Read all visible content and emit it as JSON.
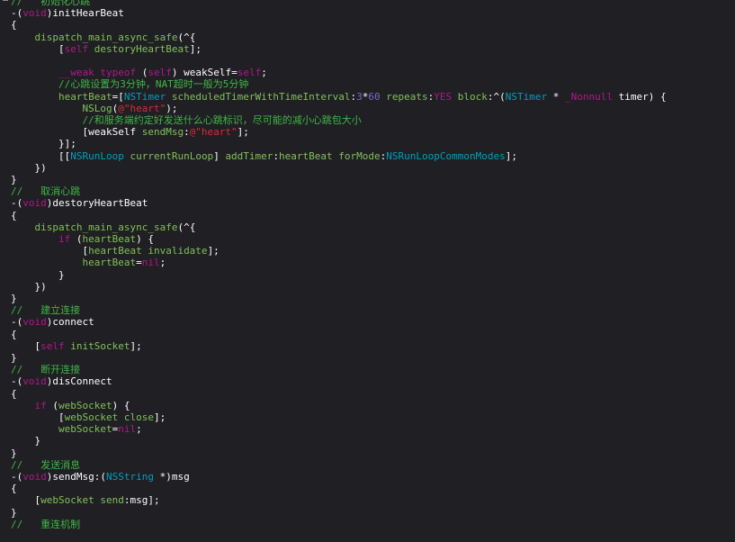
{
  "editor": {
    "background": "#1f1f24",
    "colors": {
      "plain": "#ffffff",
      "comment": "#41b645",
      "keyword": "#b21889",
      "class": "#00a0be",
      "method": "#83c057",
      "number": "#786dc4",
      "string": "#db2c38"
    },
    "lines": [
      [
        [
          "comment",
          "//   初始化心跳"
        ]
      ],
      [
        [
          "plain",
          "-("
        ],
        [
          "keyword",
          "void"
        ],
        [
          "plain",
          ")initHearBeat"
        ]
      ],
      [
        [
          "plain",
          "{"
        ]
      ],
      [
        [
          "plain",
          "    "
        ],
        [
          "method",
          "dispatch_main_async_safe"
        ],
        [
          "plain",
          "(^{"
        ]
      ],
      [
        [
          "plain",
          "        ["
        ],
        [
          "keyword",
          "self"
        ],
        [
          "plain",
          " "
        ],
        [
          "method",
          "destoryHeartBeat"
        ],
        [
          "plain",
          "];"
        ]
      ],
      [
        [
          "plain",
          ""
        ]
      ],
      [
        [
          "plain",
          "        "
        ],
        [
          "keyword",
          "__weak"
        ],
        [
          "plain",
          " "
        ],
        [
          "keyword",
          "typeof"
        ],
        [
          "plain",
          " ("
        ],
        [
          "keyword",
          "self"
        ],
        [
          "plain",
          ") weakSelf="
        ],
        [
          "keyword",
          "self"
        ],
        [
          "plain",
          ";"
        ]
      ],
      [
        [
          "plain",
          "        "
        ],
        [
          "comment",
          "//心跳设置为3分钟，NAT超时一般为5分钟"
        ]
      ],
      [
        [
          "plain",
          "        "
        ],
        [
          "prop",
          "heartBeat"
        ],
        [
          "plain",
          "=["
        ],
        [
          "class",
          "NSTimer"
        ],
        [
          "plain",
          " "
        ],
        [
          "method",
          "scheduledTimerWithTimeInterval"
        ],
        [
          "plain",
          ":"
        ],
        [
          "number",
          "3"
        ],
        [
          "plain",
          "*"
        ],
        [
          "number",
          "60"
        ],
        [
          "plain",
          " "
        ],
        [
          "method",
          "repeats"
        ],
        [
          "plain",
          ":"
        ],
        [
          "keyword",
          "YES"
        ],
        [
          "plain",
          " "
        ],
        [
          "method",
          "block"
        ],
        [
          "plain",
          ":^("
        ],
        [
          "class",
          "NSTimer"
        ],
        [
          "plain",
          " * "
        ],
        [
          "keyword",
          "_Nonnull"
        ],
        [
          "plain",
          " timer) {"
        ]
      ],
      [
        [
          "plain",
          "            "
        ],
        [
          "method",
          "NSLog"
        ],
        [
          "plain",
          "("
        ],
        [
          "string",
          "@\"heart\""
        ],
        [
          "plain",
          ");"
        ]
      ],
      [
        [
          "plain",
          "            "
        ],
        [
          "comment",
          "//和服务端约定好发送什么心跳标识，尽可能的减小心跳包大小"
        ]
      ],
      [
        [
          "plain",
          "            [weakSelf "
        ],
        [
          "method",
          "sendMsg"
        ],
        [
          "plain",
          ":"
        ],
        [
          "string",
          "@\"heart\""
        ],
        [
          "plain",
          "];"
        ]
      ],
      [
        [
          "plain",
          "        }];"
        ]
      ],
      [
        [
          "plain",
          "        [["
        ],
        [
          "class",
          "NSRunLoop"
        ],
        [
          "plain",
          " "
        ],
        [
          "method",
          "currentRunLoop"
        ],
        [
          "plain",
          "] "
        ],
        [
          "method",
          "addTimer"
        ],
        [
          "plain",
          ":"
        ],
        [
          "prop",
          "heartBeat"
        ],
        [
          "plain",
          " "
        ],
        [
          "method",
          "forMode"
        ],
        [
          "plain",
          ":"
        ],
        [
          "class",
          "NSRunLoopCommonModes"
        ],
        [
          "plain",
          "];"
        ]
      ],
      [
        [
          "plain",
          "    })"
        ]
      ],
      [
        [
          "plain",
          "}"
        ]
      ],
      [
        [
          "comment",
          "//   取消心跳"
        ]
      ],
      [
        [
          "plain",
          "-("
        ],
        [
          "keyword",
          "void"
        ],
        [
          "plain",
          ")destoryHeartBeat"
        ]
      ],
      [
        [
          "plain",
          "{"
        ]
      ],
      [
        [
          "plain",
          "    "
        ],
        [
          "method",
          "dispatch_main_async_safe"
        ],
        [
          "plain",
          "(^{"
        ]
      ],
      [
        [
          "plain",
          "        "
        ],
        [
          "keyword",
          "if"
        ],
        [
          "plain",
          " ("
        ],
        [
          "prop",
          "heartBeat"
        ],
        [
          "plain",
          ") {"
        ]
      ],
      [
        [
          "plain",
          "            ["
        ],
        [
          "prop",
          "heartBeat"
        ],
        [
          "plain",
          " "
        ],
        [
          "method",
          "invalidate"
        ],
        [
          "plain",
          "];"
        ]
      ],
      [
        [
          "plain",
          "            "
        ],
        [
          "prop",
          "heartBeat"
        ],
        [
          "plain",
          "="
        ],
        [
          "keyword",
          "nil"
        ],
        [
          "plain",
          ";"
        ]
      ],
      [
        [
          "plain",
          "        }"
        ]
      ],
      [
        [
          "plain",
          "    })"
        ]
      ],
      [
        [
          "plain",
          "}"
        ]
      ],
      [
        [
          "comment",
          "//   建立连接"
        ]
      ],
      [
        [
          "plain",
          "-("
        ],
        [
          "keyword",
          "void"
        ],
        [
          "plain",
          ")connect"
        ]
      ],
      [
        [
          "plain",
          "{"
        ]
      ],
      [
        [
          "plain",
          "    ["
        ],
        [
          "keyword",
          "self"
        ],
        [
          "plain",
          " "
        ],
        [
          "method",
          "initSocket"
        ],
        [
          "plain",
          "];"
        ]
      ],
      [
        [
          "plain",
          "}"
        ]
      ],
      [
        [
          "comment",
          "//   断开连接"
        ]
      ],
      [
        [
          "plain",
          "-("
        ],
        [
          "keyword",
          "void"
        ],
        [
          "plain",
          ")disConnect"
        ]
      ],
      [
        [
          "plain",
          "{"
        ]
      ],
      [
        [
          "plain",
          "    "
        ],
        [
          "keyword",
          "if"
        ],
        [
          "plain",
          " ("
        ],
        [
          "prop",
          "webSocket"
        ],
        [
          "plain",
          ") {"
        ]
      ],
      [
        [
          "plain",
          "        ["
        ],
        [
          "prop",
          "webSocket"
        ],
        [
          "plain",
          " "
        ],
        [
          "method",
          "close"
        ],
        [
          "plain",
          "];"
        ]
      ],
      [
        [
          "plain",
          "        "
        ],
        [
          "prop",
          "webSocket"
        ],
        [
          "plain",
          "="
        ],
        [
          "keyword",
          "nil"
        ],
        [
          "plain",
          ";"
        ]
      ],
      [
        [
          "plain",
          "    }"
        ]
      ],
      [
        [
          "plain",
          "}"
        ]
      ],
      [
        [
          "comment",
          "//   发送消息"
        ]
      ],
      [
        [
          "plain",
          "-("
        ],
        [
          "keyword",
          "void"
        ],
        [
          "plain",
          ")sendMsg:("
        ],
        [
          "class",
          "NSString"
        ],
        [
          "plain",
          " *)msg"
        ]
      ],
      [
        [
          "plain",
          "{"
        ]
      ],
      [
        [
          "plain",
          "    ["
        ],
        [
          "prop",
          "webSocket"
        ],
        [
          "plain",
          " "
        ],
        [
          "method",
          "send"
        ],
        [
          "plain",
          ":msg];"
        ]
      ],
      [
        [
          "plain",
          "}"
        ]
      ],
      [
        [
          "comment",
          "//   重连机制"
        ]
      ]
    ]
  }
}
